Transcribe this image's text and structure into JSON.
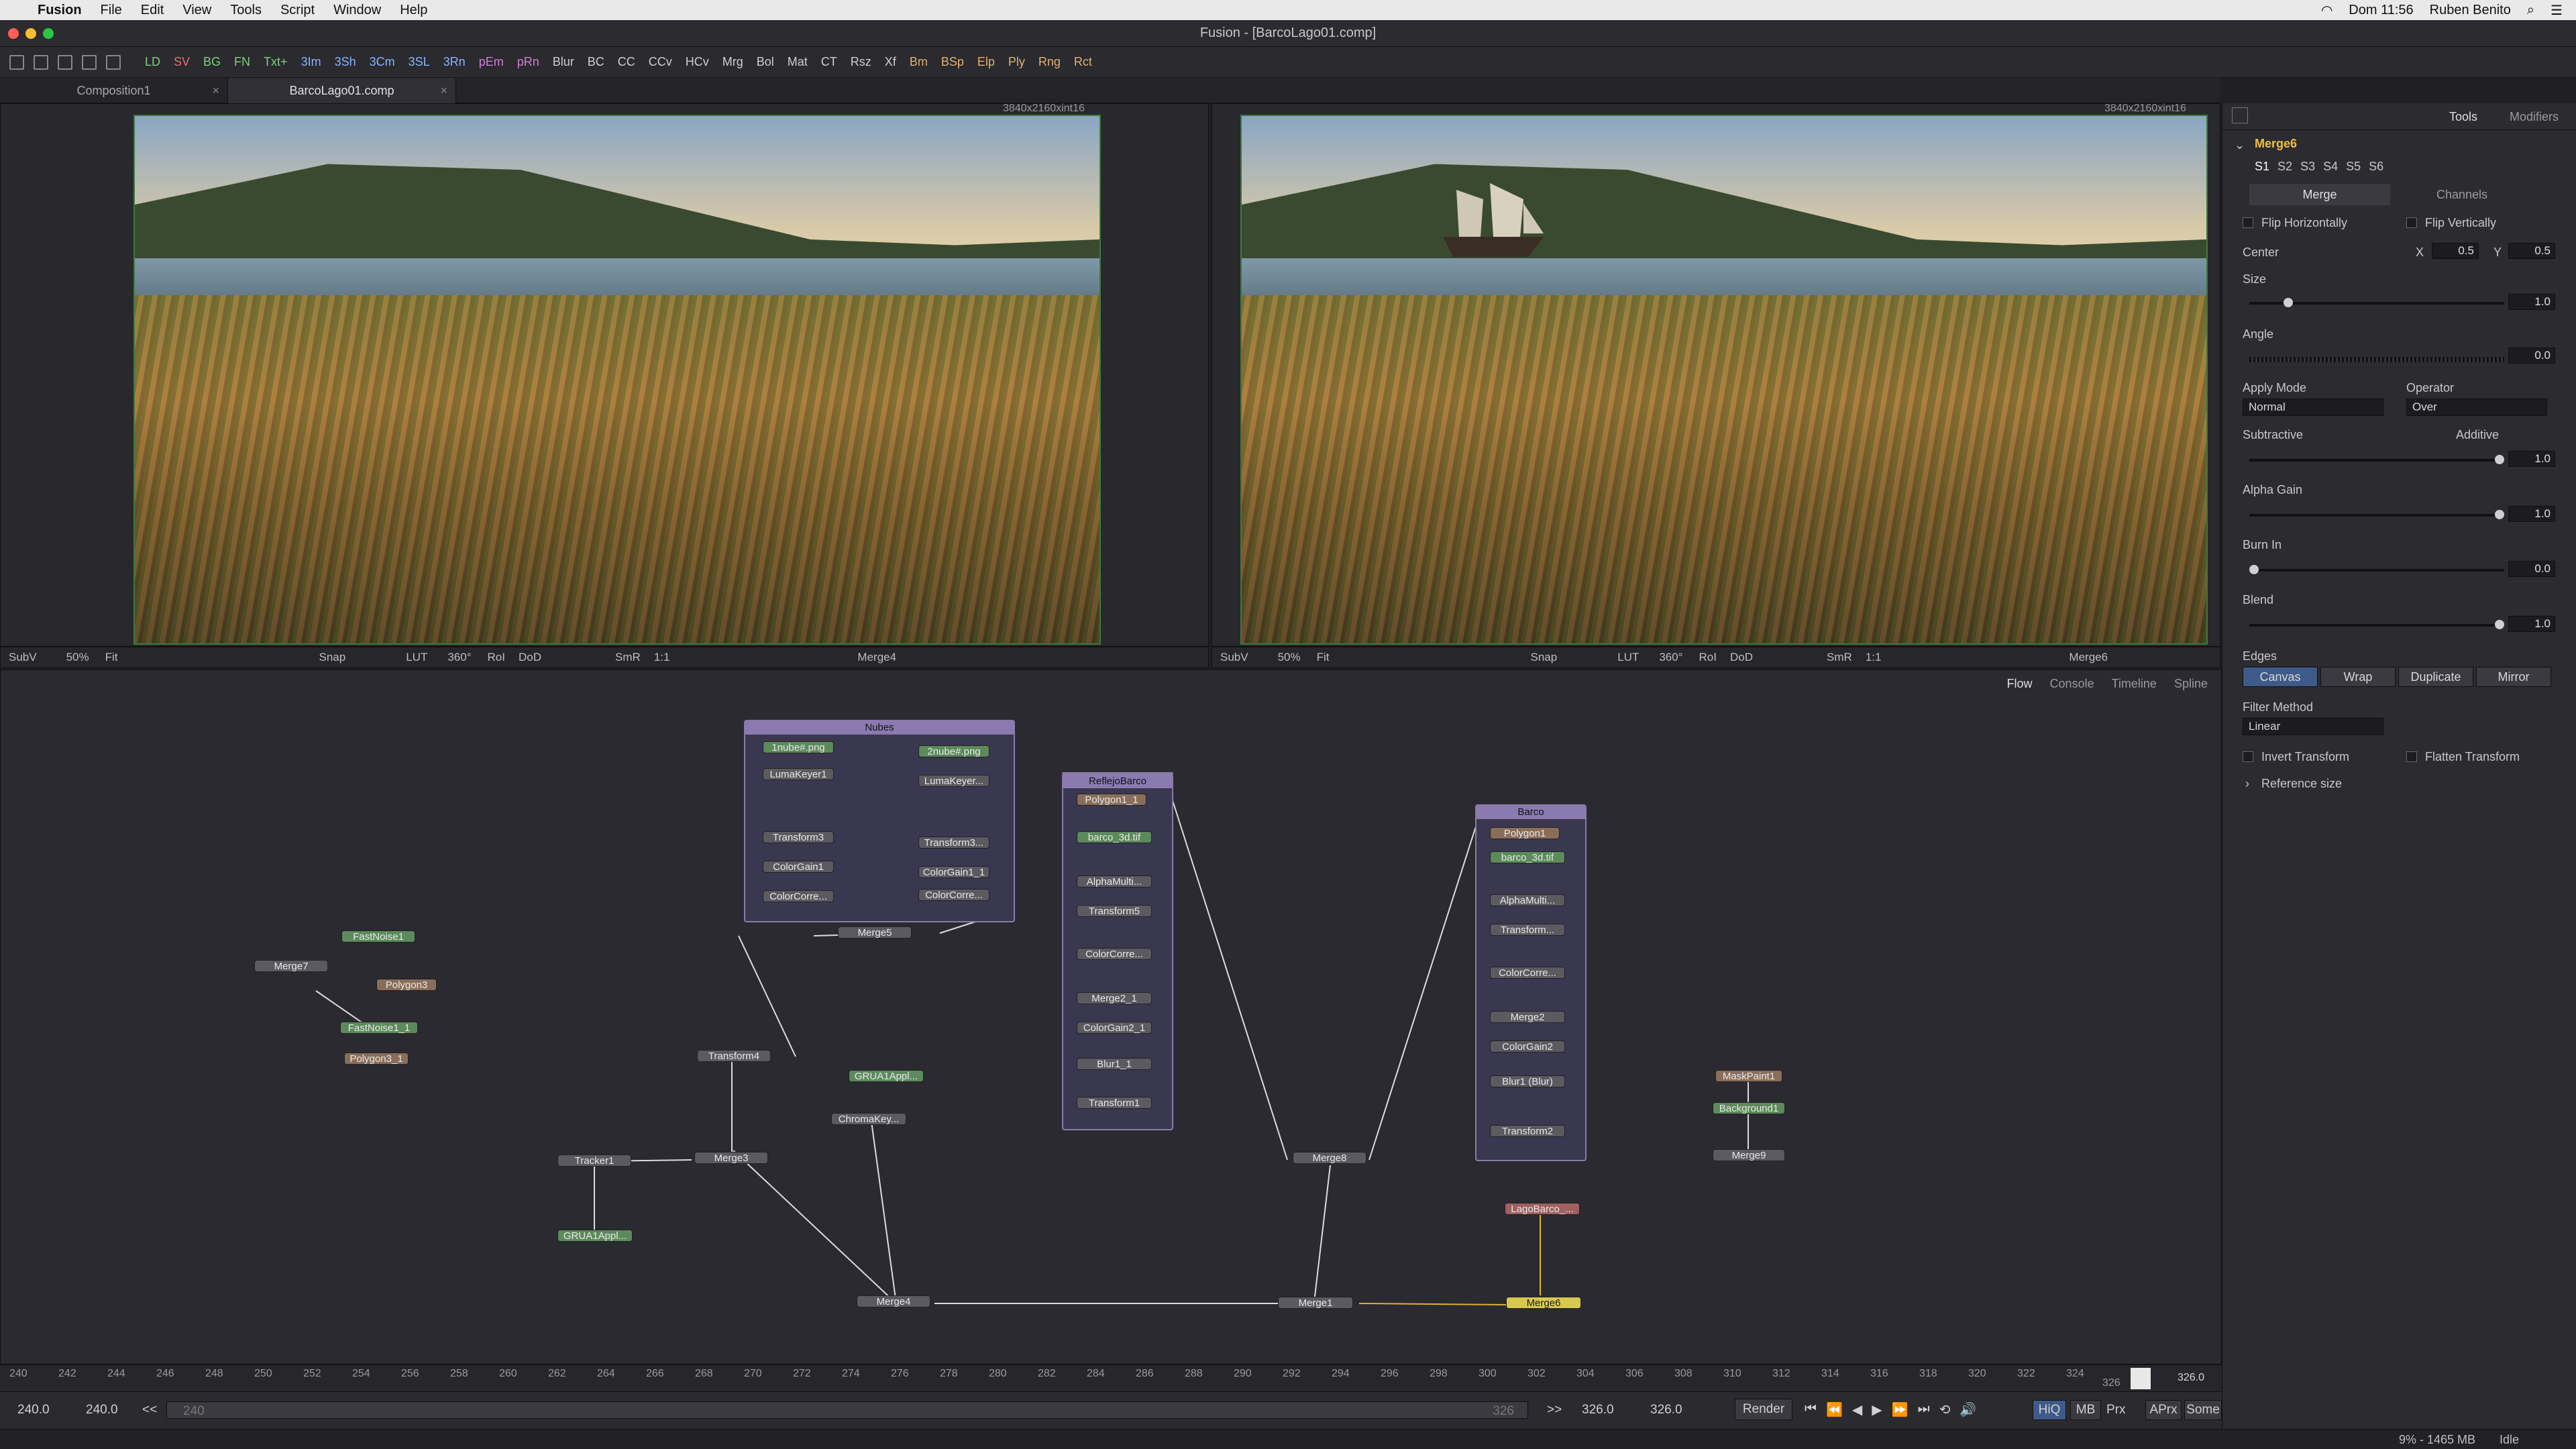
{
  "menubar": {
    "app": "Fusion",
    "items": [
      "File",
      "Edit",
      "View",
      "Tools",
      "Script",
      "Window",
      "Help"
    ],
    "clock": "Dom 11:56",
    "user": "Ruben Benito"
  },
  "window_title": "Fusion - [BarcoLago01.comp]",
  "toolbar": [
    "LD",
    "SV",
    "BG",
    "FN",
    "Txt+",
    "3Im",
    "3Sh",
    "3Cm",
    "3SL",
    "3Rn",
    "pEm",
    "pRn",
    "Blur",
    "BC",
    "CC",
    "CCv",
    "HCv",
    "Mrg",
    "Bol",
    "Mat",
    "CT",
    "Rsz",
    "Xf",
    "Bm",
    "BSp",
    "Elp",
    "Ply",
    "Rng",
    "Rct"
  ],
  "toolbar_colors": {
    "LD": "#7fd07f",
    "SV": "#e07070",
    "BG": "#7fd07f",
    "FN": "#7fd07f",
    "Txt+": "#7fd07f",
    "3Im": "#8ab4ff",
    "3Sh": "#8ab4ff",
    "3Cm": "#8ab4ff",
    "3SL": "#8ab4ff",
    "3Rn": "#8ab4ff",
    "pEm": "#d07fd0",
    "pRn": "#d07fd0",
    "Bm": "#e0b070",
    "BSp": "#e0b070",
    "Elp": "#e0b070",
    "Ply": "#e0b070",
    "Rng": "#e0b070",
    "Rct": "#e0b070"
  },
  "tabs": [
    {
      "label": "Composition1"
    },
    {
      "label": "BarcoLago01.comp"
    }
  ],
  "viewer_left": {
    "resolution": "3840x2160xint16",
    "bar": {
      "subv": "SubV",
      "zoom": "50%",
      "fit": "Fit",
      "snap": "Snap",
      "lut": "LUT",
      "angle": "360°",
      "roi": "RoI",
      "dod": "DoD",
      "smr": "SmR",
      "ratio": "1:1",
      "node": "Merge4"
    }
  },
  "viewer_right": {
    "resolution": "3840x2160xint16",
    "bar": {
      "subv": "SubV",
      "zoom": "50%",
      "fit": "Fit",
      "snap": "Snap",
      "lut": "LUT",
      "angle": "360°",
      "roi": "RoI",
      "dod": "DoD",
      "smr": "SmR",
      "ratio": "1:1",
      "node": "Merge6"
    }
  },
  "flow_tabs": [
    "Flow",
    "Console",
    "Timeline",
    "Spline"
  ],
  "groups": {
    "nubes": "Nubes",
    "reflejo": "ReflejoBarco",
    "barco": "Barco"
  },
  "nodes": {
    "merge7": "Merge7",
    "fastnoise1": "FastNoise1",
    "polygon3": "Polygon3",
    "fastnoise1_1": "FastNoise1_1",
    "polygon3_1": "Polygon3_1",
    "nube1": "1nube#.png",
    "lumakeyer1": "LumaKeyer1",
    "transform3": "Transform3",
    "colorgain1": "ColorGain1",
    "colorcorre1": "ColorCorre...",
    "nube2": "2nube#.png",
    "lumakeyer2": "LumaKeyer...",
    "transform3b": "Transform3...",
    "colorgain1_1": "ColorGain1_1",
    "colorcorre2": "ColorCorre...",
    "merge5": "Merge5",
    "polygon_r": "Polygon1_1",
    "barco_r": "barco_3d.tif",
    "alphamulti_r": "AlphaMulti...",
    "transform5": "Transform5",
    "colorcorre_r": "ColorCorre...",
    "merge2_1": "Merge2_1",
    "colorgain2_1": "ColorGain2_1",
    "blur1_1": "Blur1_1",
    "transform1": "Transform1",
    "polygon_b": "Polygon1",
    "barco_b": "barco_3d.tif",
    "alphamulti_b": "AlphaMulti...",
    "transform_b": "Transform...",
    "colorcorre_b": "ColorCorre...",
    "merge2": "Merge2",
    "colorgain2": "ColorGain2",
    "blur1": "Blur1 (Blur)",
    "transform2": "Transform2",
    "transform4": "Transform4",
    "grua1appl": "GRUA1Appl...",
    "chromakey": "ChromaKey...",
    "tracker1": "Tracker1",
    "merge3": "Merge3",
    "grua1appl2": "GRUA1Appl...",
    "merge4": "Merge4",
    "merge8": "Merge8",
    "merge1": "Merge1",
    "lagobarco": "LagoBarco_...",
    "merge6": "Merge6",
    "maskpaint1": "MaskPaint1",
    "background1": "Background1",
    "merge9": "Merge9"
  },
  "ruler_ticks": [
    "240",
    "242",
    "244",
    "246",
    "248",
    "250",
    "252",
    "254",
    "256",
    "258",
    "260",
    "262",
    "264",
    "266",
    "268",
    "270",
    "272",
    "274",
    "276",
    "278",
    "280",
    "282",
    "284",
    "286",
    "288",
    "290",
    "292",
    "294",
    "296",
    "298",
    "300",
    "302",
    "304",
    "306",
    "308",
    "310",
    "312",
    "314",
    "316",
    "318",
    "320",
    "322",
    "324"
  ],
  "ruler_current": "326",
  "ruler_end": "326.0",
  "transport": {
    "start": "240.0",
    "start2": "240.0",
    "range_start": "240",
    "range_end": "326",
    "end": "326.0",
    "end2": "326.0",
    "render": "Render",
    "hiq": "HiQ",
    "mb": "MB",
    "prx": "Prx",
    "aprx": "APrx",
    "some": "Some",
    "prev": "<<",
    "next": ">>"
  },
  "status": {
    "memory": "9% - 1465 MB",
    "state": "Idle"
  },
  "inspector": {
    "tabs": [
      "Tools",
      "Modifiers"
    ],
    "node": "Merge6",
    "slots": [
      "S1",
      "S2",
      "S3",
      "S4",
      "S5",
      "S6"
    ],
    "subtabs": [
      "Merge",
      "Channels"
    ],
    "flip_h": "Flip Horizontally",
    "flip_v": "Flip Vertically",
    "center_label": "Center",
    "center_x_label": "X",
    "center_x": "0.5",
    "center_y_label": "Y",
    "center_y": "0.5",
    "size_label": "Size",
    "size": "1.0",
    "size_level": 0.14,
    "angle_label": "Angle",
    "angle": "0.0",
    "angle_level": 0.5,
    "apply_mode_label": "Apply Mode",
    "apply_mode": "Normal",
    "operator_label": "Operator",
    "operator": "Over",
    "subtractive_label": "Subtractive",
    "additive_label": "Additive",
    "sub_add": "1.0",
    "sub_add_level": 1.0,
    "alpha_gain_label": "Alpha Gain",
    "alpha_gain": "1.0",
    "alpha_gain_level": 1.0,
    "burn_in_label": "Burn In",
    "burn_in": "0.0",
    "burn_in_level": 0.0,
    "blend_label": "Blend",
    "blend": "1.0",
    "blend_level": 1.0,
    "edges_label": "Edges",
    "edges": [
      "Canvas",
      "Wrap",
      "Duplicate",
      "Mirror"
    ],
    "filter_method_label": "Filter Method",
    "filter_method": "Linear",
    "invert_transform": "Invert Transform",
    "flatten_transform": "Flatten Transform",
    "reference_size": "Reference size"
  }
}
